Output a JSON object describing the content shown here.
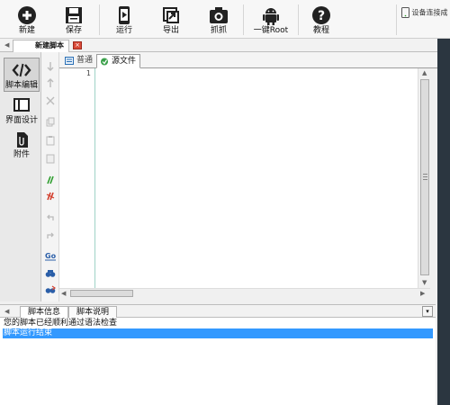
{
  "toolbar": {
    "buttons": [
      {
        "label": "新建",
        "icon": "plus-circle-icon"
      },
      {
        "label": "保存",
        "icon": "floppy-disk-icon"
      },
      {
        "label": "运行",
        "icon": "phone-play-icon"
      },
      {
        "label": "导出",
        "icon": "export-icon"
      },
      {
        "label": "抓抓",
        "icon": "camera-icon"
      },
      {
        "label": "一键Root",
        "icon": "android-icon"
      },
      {
        "label": "教程",
        "icon": "help-icon"
      }
    ],
    "device_status": "设备连接成"
  },
  "file_tab": {
    "label": "新建脚本",
    "close": "×"
  },
  "sidebar": {
    "items": [
      {
        "label": "脚本编辑",
        "icon": "code-icon"
      },
      {
        "label": "界面设计",
        "icon": "layout-icon"
      },
      {
        "label": "附件",
        "icon": "attachment-icon"
      }
    ]
  },
  "editor_tabs": [
    {
      "label": "普通"
    },
    {
      "label": "源文件"
    }
  ],
  "editor": {
    "line_numbers": [
      "1"
    ],
    "content": ""
  },
  "bottom_tabs": [
    {
      "label": "脚本信息"
    },
    {
      "label": "脚本说明"
    }
  ],
  "log": {
    "lines": [
      "您的脚本已经顺利通过语法检查",
      "脚本运行结束"
    ]
  },
  "colors": {
    "selection": "#3399ff",
    "right_panel": "#2b3640"
  }
}
